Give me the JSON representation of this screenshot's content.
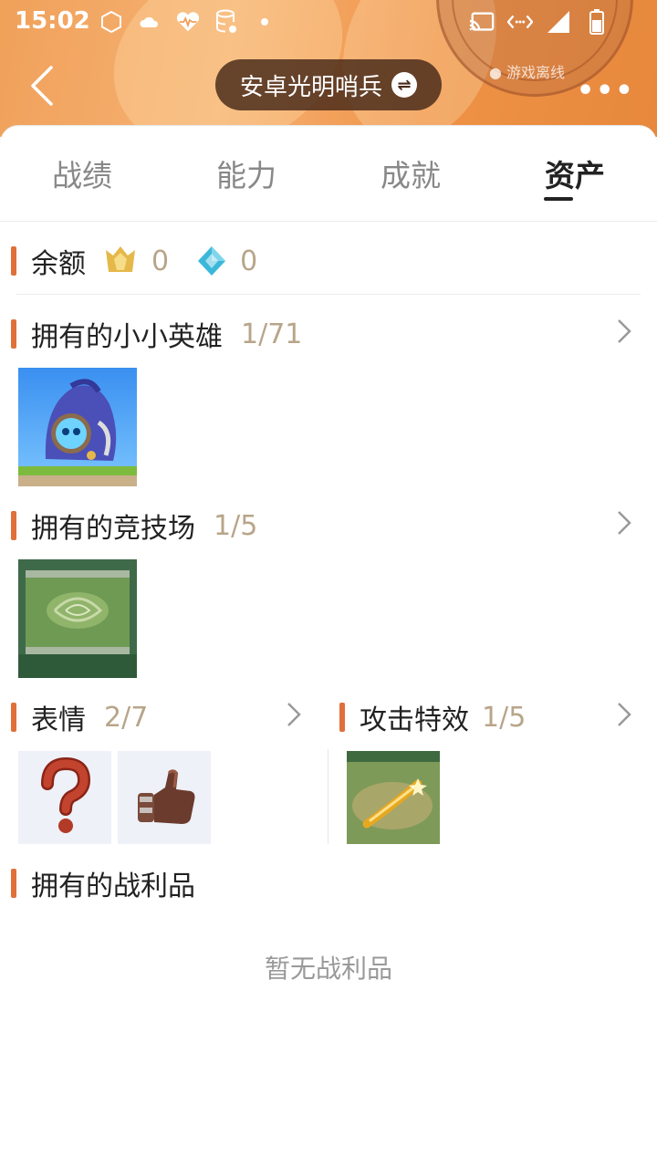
{
  "status_bar": {
    "time": "15:02",
    "left_icons": [
      "hexagon-icon",
      "cloud-icon",
      "heart-pulse-icon",
      "database-icon",
      "dot-icon"
    ],
    "right_icons": [
      "cast-icon",
      "data-arrows-icon",
      "signal-icon",
      "battery-icon"
    ]
  },
  "header": {
    "title": "安卓光明哨兵",
    "offline_label": "游戏离线",
    "more_label": "•••"
  },
  "tabs": [
    {
      "label": "战绩",
      "active": false
    },
    {
      "label": "能力",
      "active": false
    },
    {
      "label": "成就",
      "active": false
    },
    {
      "label": "资产",
      "active": true
    }
  ],
  "balance": {
    "label": "余额",
    "gold_value": "0",
    "gem_value": "0"
  },
  "little_legends": {
    "title": "拥有的小小英雄",
    "count": "1/71"
  },
  "arenas": {
    "title": "拥有的竞技场",
    "count": "1/5"
  },
  "emotes": {
    "title": "表情",
    "count": "2/7"
  },
  "attack_effects": {
    "title": "攻击特效",
    "count": "1/5"
  },
  "loot": {
    "title": "拥有的战利品",
    "empty_text": "暂无战利品"
  },
  "colors": {
    "accent_bar": "#e0703a",
    "count_text": "#b8a58a",
    "header_orange": "#f0a15a"
  }
}
